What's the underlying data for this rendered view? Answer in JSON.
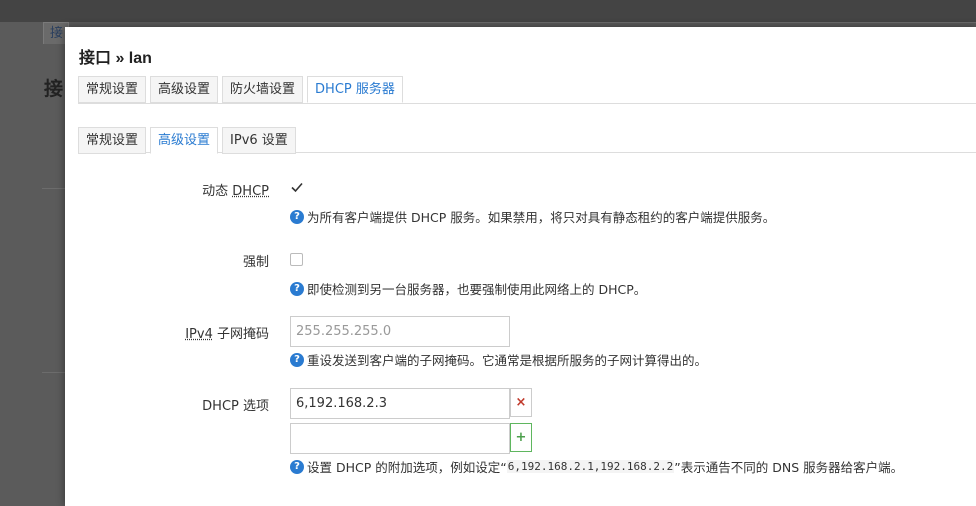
{
  "background": {
    "tab_label": "接口",
    "heading": "接"
  },
  "modal": {
    "title": "接口 » lan",
    "main_tabs": [
      {
        "label": "常规设置",
        "active": false
      },
      {
        "label": "高级设置",
        "active": false
      },
      {
        "label": "防火墙设置",
        "active": false
      },
      {
        "label": "DHCP 服务器",
        "active": true
      }
    ],
    "sub_tabs": [
      {
        "label": "常规设置",
        "active": false
      },
      {
        "label": "高级设置",
        "active": true
      },
      {
        "label": "IPv6 设置",
        "active": false
      }
    ],
    "fields": {
      "dynamic_dhcp": {
        "label_prefix": "动态 ",
        "label_term": "DHCP",
        "checked": true,
        "description": "为所有客户端提供 DHCP 服务。如果禁用，将只对具有静态租约的客户端提供服务。"
      },
      "force": {
        "label": "强制",
        "checked": false,
        "description": "即使检测到另一台服务器，也要强制使用此网络上的 DHCP。"
      },
      "ipv4_netmask": {
        "label_term": "IPv4",
        "label_suffix": " 子网掩码",
        "placeholder": "255.255.255.0",
        "value": "",
        "description": "重设发送到客户端的子网掩码。它通常是根据所服务的子网计算得出的。"
      },
      "dhcp_options": {
        "label": "DHCP 选项",
        "values": [
          "6,192.168.2.3",
          ""
        ],
        "remove_symbol": "×",
        "add_symbol": "+",
        "description_before": "设置 DHCP 的附加选项，例如设定“",
        "description_code": "6,192.168.2.1,192.168.2.2",
        "description_after": "”表示通告不同的 DNS 服务器给客户端。"
      }
    },
    "help_icon_symbol": "?",
    "icons": {
      "help": "question-circle-icon",
      "check": "checkmark-icon"
    },
    "colors": {
      "accent": "#2a7bd1",
      "remove": "#c0392b",
      "add": "#4c9f4c"
    }
  }
}
